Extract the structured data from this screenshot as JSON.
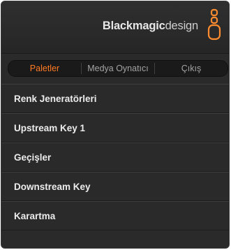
{
  "header": {
    "brand_part1": "Blackmagic",
    "brand_part2": "design",
    "logo_color": "#ff8c2e"
  },
  "tabs": [
    {
      "label": "Paletler",
      "active": true
    },
    {
      "label": "Medya Oynatıcı",
      "active": false
    },
    {
      "label": "Çıkış",
      "active": false
    }
  ],
  "list": {
    "items": [
      {
        "label": "Renk Jeneratörleri"
      },
      {
        "label": "Upstream Key 1"
      },
      {
        "label": "Geçişler"
      },
      {
        "label": "Downstream Key"
      },
      {
        "label": "Karartma"
      }
    ]
  },
  "colors": {
    "accent": "#ff7a23",
    "panel_bg": "#2a2a2a",
    "text": "#ececec"
  }
}
